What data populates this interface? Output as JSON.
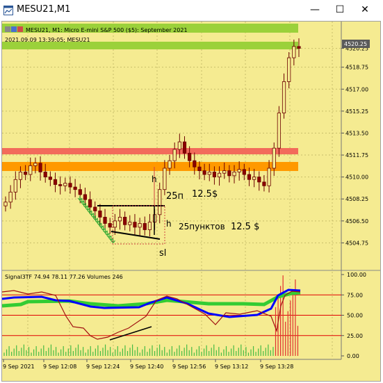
{
  "window": {
    "title": "MESU21,M1",
    "minimize": "—",
    "maximize": "☐",
    "close": "✕"
  },
  "chart_header": {
    "info": "MESU21, M1:  Micro E-mini S&P 500 ($5): September 2021",
    "timestamp": "2021.09.09 13:39:05; MESU21"
  },
  "price_axis": {
    "ticks": [
      "4520.25",
      "4518.75",
      "4517.00",
      "4515.25",
      "4513.50",
      "4511.75",
      "4510.00",
      "4508.25",
      "4506.50",
      "4504.75"
    ],
    "current_price": "4520.25",
    "current_price_color": "#5a5a5a"
  },
  "annotations": {
    "h_upper": "h",
    "label_25p": "25п",
    "label_12_5": "12.5$",
    "h_lower": "h",
    "label_25_points": "25пунктов",
    "label_12_5_s": "12.5 $",
    "sl": "sl"
  },
  "indicator": {
    "header": "Signal3TF 74.94 78.11 77.26 Volumes 246",
    "ticks": [
      "100.00",
      "75.00",
      "50.00",
      "25.00",
      "0.00"
    ]
  },
  "time_axis": {
    "labels": [
      "9 Sep 2021",
      "9 Sep 12:08",
      "9 Sep 12:24",
      "9 Sep 12:40",
      "9 Sep 12:56",
      "9 Sep 13:12",
      "9 Sep 13:28"
    ]
  },
  "colors": {
    "chart_bg": "#f5eb91",
    "candles": "#8b0000",
    "zone_green": "#9bd13a",
    "zone_red": "#f26b5b",
    "zone_orange": "#ff9900",
    "line_blue": "#0000ff",
    "line_green": "#33cc33",
    "line_darkred": "#a01010",
    "level_red": "#e00000"
  },
  "chart_data": {
    "type": "candlestick",
    "title": "MESU21, M1:  Micro E-mini S&P 500 ($5): September 2021",
    "ylim": [
      4503.5,
      4521.5
    ],
    "y_ticks": [
      4520.25,
      4518.75,
      4517.0,
      4515.25,
      4513.5,
      4511.75,
      4510.0,
      4508.25,
      4506.5,
      4504.75
    ],
    "x_labels": [
      "9 Sep 2021",
      "9 Sep 12:08",
      "9 Sep 12:24",
      "9 Sep 12:40",
      "9 Sep 12:56",
      "9 Sep 13:12",
      "9 Sep 13:28"
    ],
    "closes": [
      4508.0,
      4508.8,
      4509.8,
      4510.4,
      4510.2,
      4510.9,
      4511.1,
      4510.4,
      4510.0,
      4509.8,
      4509.4,
      4509.3,
      4509.5,
      4509.2,
      4509.0,
      4508.6,
      4508.2,
      4507.6,
      4507.3,
      4506.8,
      4506.3,
      4506.0,
      4506.5,
      4506.8,
      4506.2,
      4506.4,
      4506.0,
      4506.3,
      4505.8,
      4506.4,
      4507.0,
      4509.0,
      4510.7,
      4511.3,
      4512.2,
      4512.8,
      4511.9,
      4511.3,
      4510.8,
      4510.5,
      4510.2,
      4510.4,
      4510.0,
      4510.3,
      4510.5,
      4510.1,
      4510.4,
      4510.6,
      4510.2,
      4509.8,
      4510.0,
      4509.6,
      4509.3,
      4510.7,
      4512.3,
      4515.1,
      4517.6,
      4519.5,
      4520.4,
      4520.25
    ],
    "zones": [
      {
        "name": "green",
        "from": 4520.1,
        "to": 4520.6
      },
      {
        "name": "green_top",
        "from": 4521.0,
        "to": 4521.5
      },
      {
        "name": "red",
        "from": 4511.6,
        "to": 4512.1
      },
      {
        "name": "orange",
        "from": 4510.3,
        "to": 4511.0
      }
    ],
    "indicator": {
      "name": "Signal3TF",
      "values": [
        74.94,
        78.11,
        77.26
      ],
      "volume": 246,
      "ylim": [
        0,
        100
      ],
      "levels": [
        75,
        50,
        25
      ]
    }
  }
}
